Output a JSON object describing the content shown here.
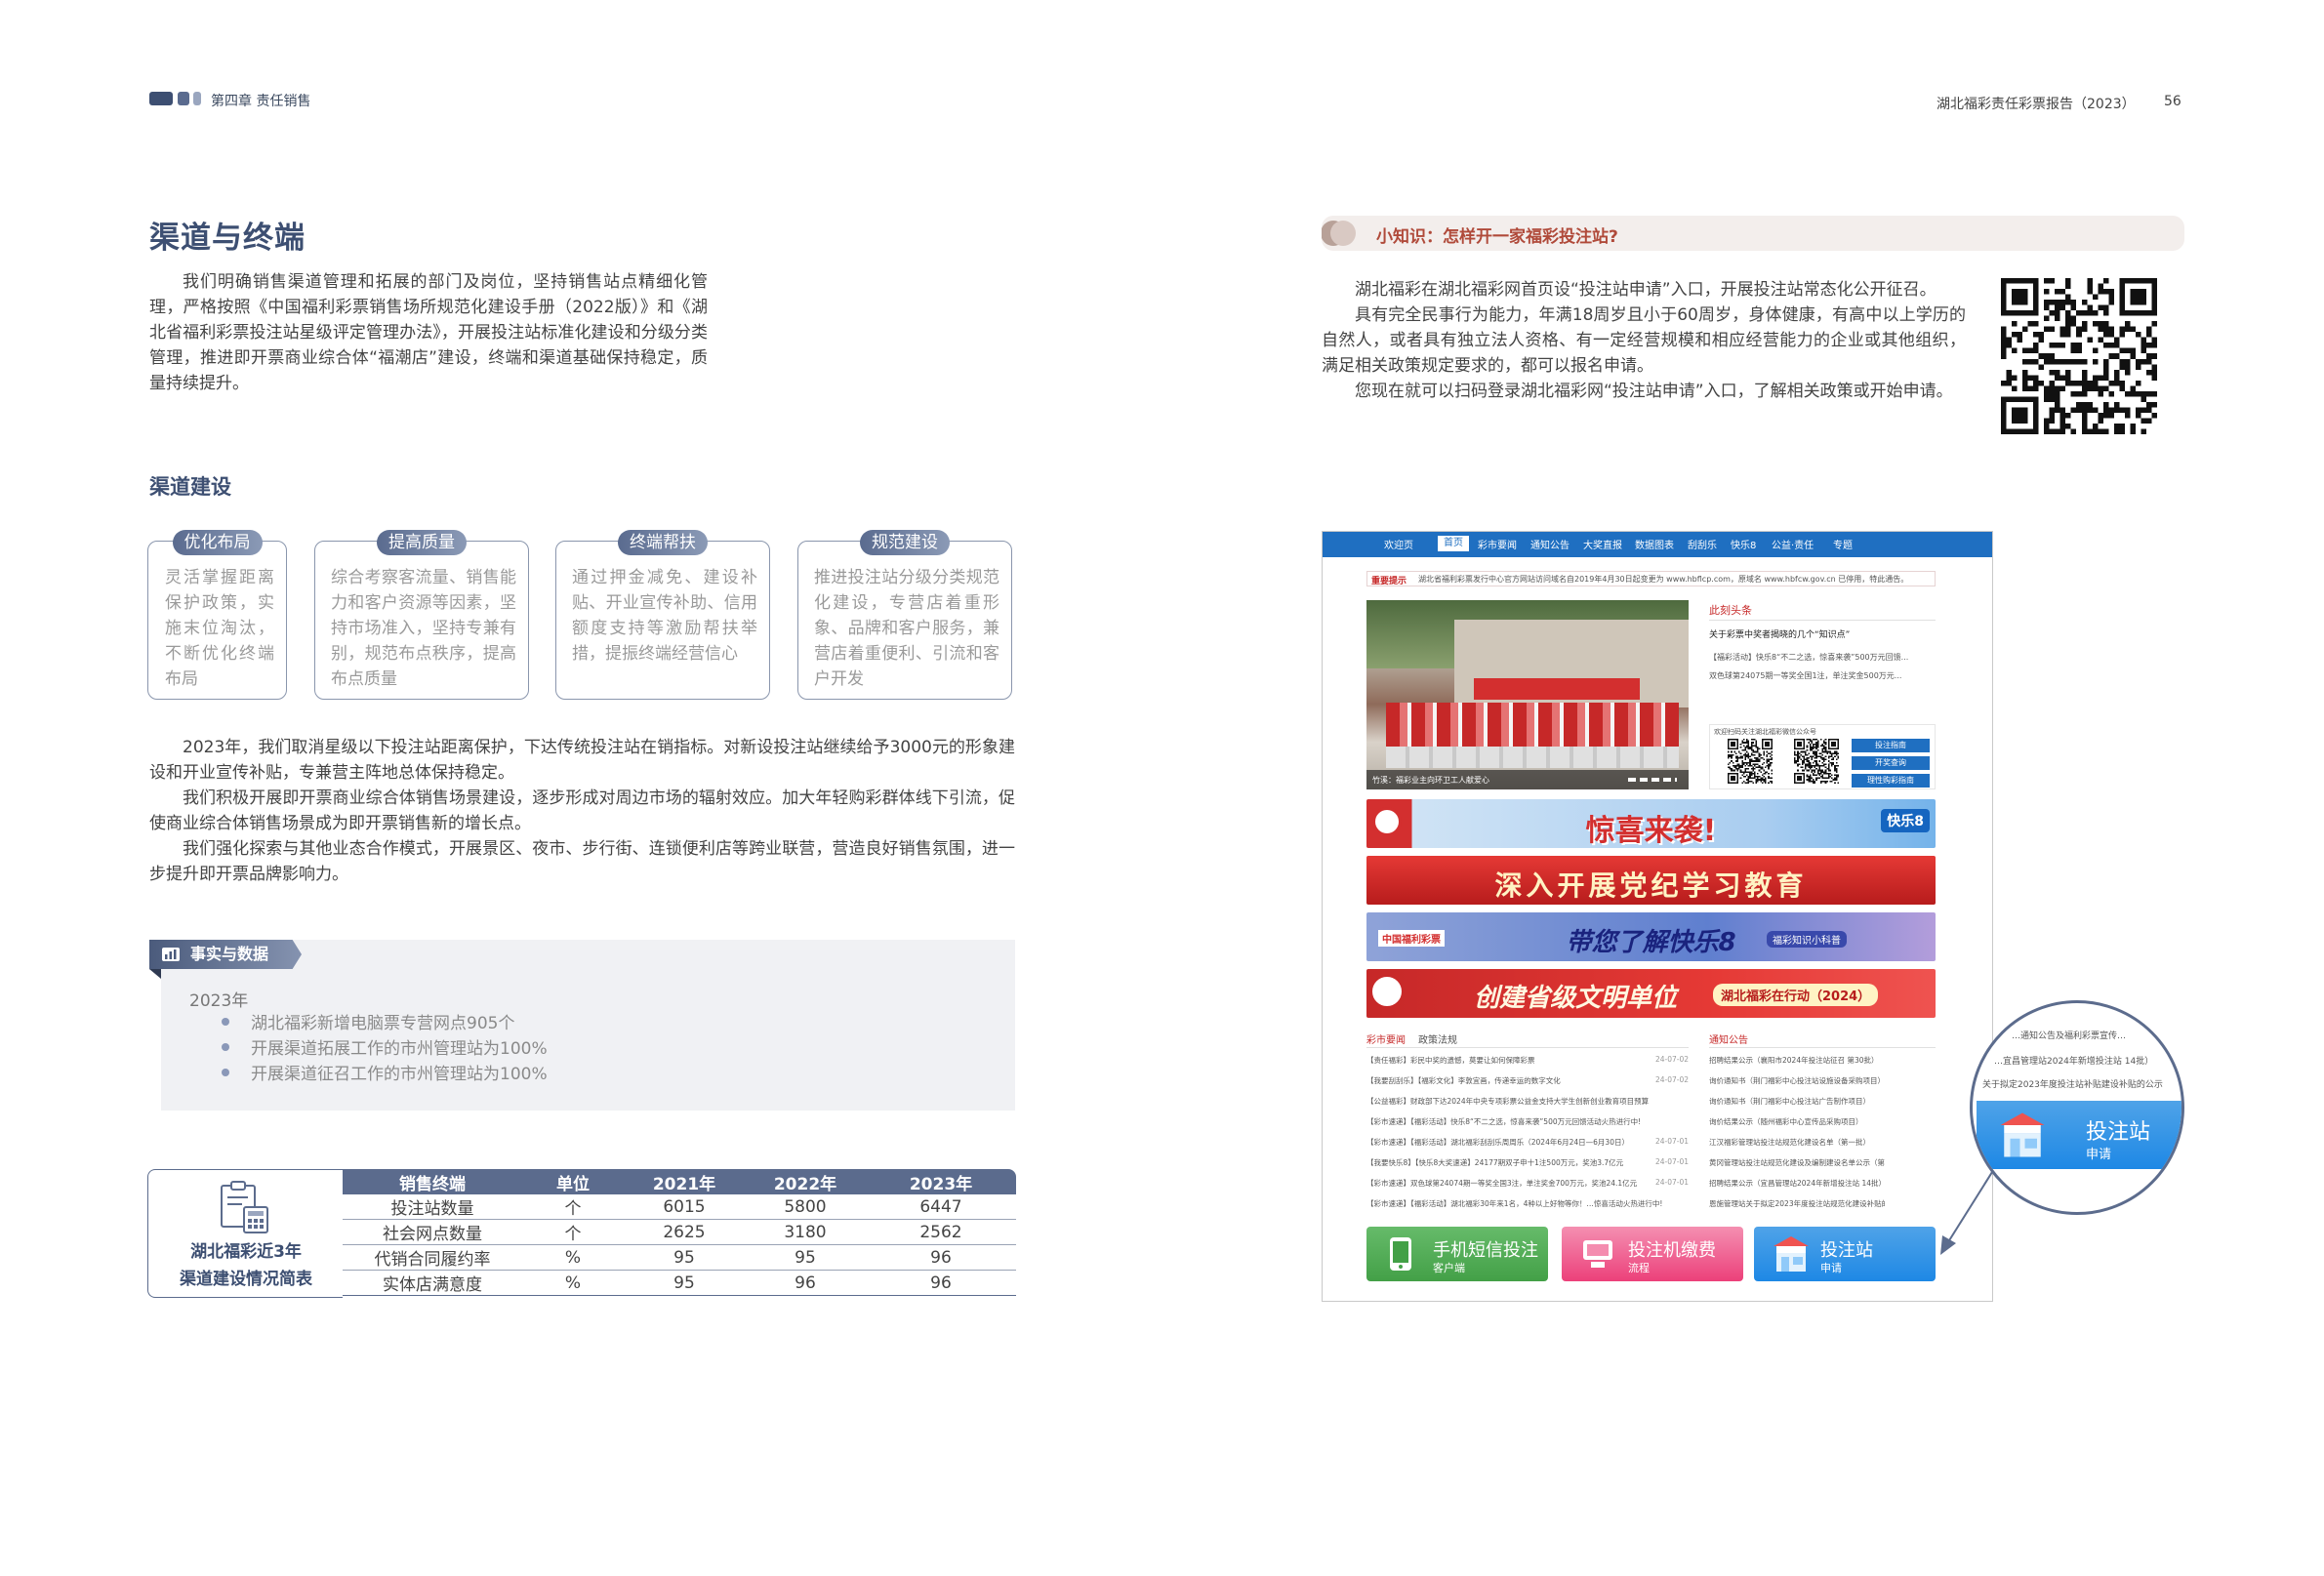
{
  "header": {
    "chapter": "第四章  责任销售",
    "report_title": "湖北福彩责任彩票报告（2023）",
    "page_number": "56"
  },
  "left": {
    "title": "渠道与终端",
    "intro": "我们明确销售渠道管理和拓展的部门及岗位，坚持销售站点精细化管理，严格按照《中国福利彩票销售场所规范化建设手册（2022版）》和《湖北省福利彩票投注站星级评定管理办法》，开展投注站标准化建设和分级分类管理，推进即开票商业综合体“福潮店”建设，终端和渠道基础保持稳定，质量持续提升。",
    "subtitle": "渠道建设",
    "cards": [
      {
        "title": "优化布局",
        "body": "灵活掌握距离保护政策，实施末位淘汰，不断优化终端布局"
      },
      {
        "title": "提高质量",
        "body": "综合考察客流量、销售能力和客户资源等因素，坚持市场准入，坚持专兼有别，规范布点秩序，提高布点质量"
      },
      {
        "title": "终端帮扶",
        "body": "通过押金减免、建设补贴、开业宣传补助、信用额度支持等激励帮扶举措，提振终端经营信心"
      },
      {
        "title": "规范建设",
        "body": "推进投注站分级分类规范化建设，专营店着重形象、品牌和客户服务，兼营店着重便利、引流和客户开发"
      }
    ],
    "paragraphs": [
      "2023年，我们取消星级以下投注站距离保护，下达传统投注站在销指标。对新设投注站继续给予3000元的形象建设和开业宣传补贴，专兼营主阵地总体保持稳定。",
      "我们积极开展即开票商业综合体销售场景建设，逐步形成对周边市场的辐射效应。加大年轻购彩群体线下引流，促使商业综合体销售场景成为即开票销售新的增长点。",
      "我们强化探索与其他业态合作模式，开展景区、夜市、步行街、连锁便利店等跨业联营，营造良好销售氛围，进一步提升即开票品牌影响力。"
    ],
    "facts": {
      "tab": "事实与数据",
      "year": "2023年",
      "items": [
        "湖北福彩新增电脑票专营网点905个",
        "开展渠道拓展工作的市州管理站为100%",
        "开展渠道征召工作的市州管理站为100%"
      ]
    },
    "table": {
      "caption_line1": "湖北福彩近3年",
      "caption_line2": "渠道建设情况简表",
      "headers": [
        "销售终端",
        "单位",
        "2021年",
        "2022年",
        "2023年"
      ],
      "rows": [
        [
          "投注站数量",
          "个",
          "6015",
          "5800",
          "6447"
        ],
        [
          "社会网点数量",
          "个",
          "2625",
          "3180",
          "2562"
        ],
        [
          "代销合同履约率",
          "%",
          "95",
          "95",
          "96"
        ],
        [
          "实体店满意度",
          "%",
          "95",
          "96",
          "96"
        ]
      ]
    }
  },
  "right": {
    "tip_title": "小知识：怎样开一家福彩投注站?",
    "tip_paragraphs": [
      "湖北福彩在湖北福彩网首页设“投注站申请”入口，开展投注站常态化公开征召。",
      "具有完全民事行为能力，年满18周岁且小于60周岁，身体健康，有高中以上学历的自然人，或者具有独立法人资格、有一定经营规模和相应经营能力的企业或其他组织，满足相关政策规定要求的，都可以报名申请。",
      "您现在就可以扫码登录湖北福彩网“投注站申请”入口，了解相关政策或开始申请。"
    ],
    "website": {
      "nav": [
        "欢迎页",
        "首页",
        "彩市要闻",
        "通知公告",
        "大奖直报",
        "数据图表",
        "刮刮乐",
        "快乐8",
        "公益·责任",
        "专题"
      ],
      "notice": "湖北省福利彩票发行中心官方网站访问域名自2019年4月30日起变更为 www.hbflcp.com，原域名 www.hbfcw.gov.cn 已停用，特此通告。",
      "notice_tag": "重要提示",
      "photo_caption": "竹溪：福彩业主向环卫工人献爱心",
      "headlines_title": "此刻头条",
      "headlines": [
        "关于彩票中奖者揭晓的几个“知识点”",
        "【福彩活动】快乐8“不二之选，惊喜来袭”500万元回馈...",
        "双色球第24075期一等奖全国1注，单注奖金500万元..."
      ],
      "follow_text": "欢迎扫码关注湖北福彩微信公众号",
      "side_buttons": [
        "投注指南",
        "开奖查询",
        "理性购彩指南"
      ],
      "banners": [
        "惊喜来袭!",
        "深入开展党纪学习教育",
        "带您了解快乐8",
        "创建省级文明单位"
      ],
      "banner_extra": [
        "湖北福彩在行动（2024）",
        "福彩知识小科普",
        "中国福利彩票",
        "快乐8"
      ],
      "news_tabs": [
        "彩市要闻",
        "政策法规"
      ],
      "news": [
        {
          "text": "【责任福彩】彩民中奖的遗憾，莫要让如何保障彩票",
          "date": "24-07-02"
        },
        {
          "text": "【我要刮刮乐】【福彩文化】李敦宜画，传递幸运的数字文化",
          "date": "24-07-02"
        },
        {
          "text": "【公益福彩】财政部下达2024年中央专项彩票公益金支持大学生创新创业教育项目预算",
          "date": ""
        },
        {
          "text": "【彩市速递】【福彩活动】快乐8“不二之选，惊喜来袭”500万元回馈活动火热进行中!",
          "date": ""
        },
        {
          "text": "【彩市速递】【福彩活动】湖北福彩刮刮乐周周乐（2024年6月24日—6月30日）",
          "date": "24-07-01"
        },
        {
          "text": "【我要快乐8】【快乐8大奖速递】24177期双子申十1注500万元，奖池3.7亿元",
          "date": "24-07-01"
        },
        {
          "text": "【彩市速递】双色球第24074期一等奖全国3注，单注奖金700万元，奖池24.1亿元",
          "date": "24-07-01"
        },
        {
          "text": "【彩市速递】【福彩活动】湖北福彩30年来1名，4种以上好物等你！…惊喜活动火热进行中!",
          "date": ""
        }
      ],
      "notice_title": "通知公告",
      "notices": [
        "招聘结果公示（襄阳市2024年投注站征召 第30批）",
        "询价通知书（荆门福彩中心投注站设施设备采购项目）",
        "询价通知书（荆门福彩中心投注站广告制作项目）",
        "询价结果公示（随州福彩中心宣传品采购项目）",
        "江汉福彩管理站投注站规范化建设名单（第一批）",
        "黄冈管理站投注站规范化建设及编制建设名单公示（第…",
        "招聘结果公示（宜昌管理站2024年新增投注站 14批）",
        "恩施管理站关于拟定2023年度投注站规范化建设补贴的公示"
      ],
      "bottom_buttons": [
        {
          "t1": "手机短信投注",
          "t2": "客户端"
        },
        {
          "t1": "投注机缴费",
          "t2": "流程"
        },
        {
          "t1": "投注站",
          "t2": "申请"
        }
      ],
      "magnifier": {
        "lines": [
          "…通知公告及福利彩票宣传…",
          "…宜昌管理站2024年新增投注站 14批）",
          "关于拟定2023年度投注站补贴建设补贴的公示"
        ],
        "t1": "投注站",
        "t2": "申请"
      }
    }
  },
  "colors": {
    "navy": "#3d4f72",
    "accent_red": "#c62828",
    "web_blue": "#1f6fc1"
  }
}
